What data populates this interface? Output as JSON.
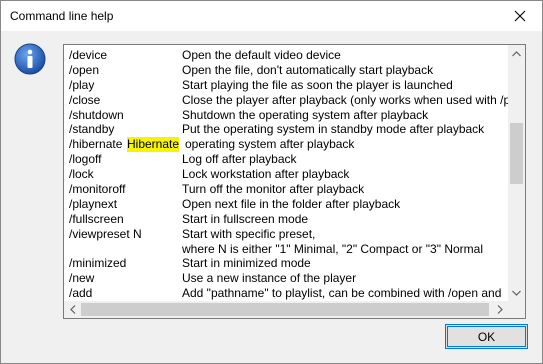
{
  "window": {
    "title": "Command line help"
  },
  "icons": {
    "close": "close-icon",
    "info": "info-icon"
  },
  "colors": {
    "highlight": "#f7f400",
    "button_border": "#0078d7"
  },
  "help": {
    "lines": [
      {
        "cmd": "/device",
        "desc": "Open the default video device"
      },
      {
        "cmd": "/open",
        "desc": "Open the file, don't automatically start playback"
      },
      {
        "cmd": "/play",
        "desc": "Start playing the file as soon the player is launched"
      },
      {
        "cmd": "/close",
        "desc": "Close the player after playback (only works when used with /p"
      },
      {
        "cmd": "/shutdown",
        "desc": "Shutdown the operating system after playback"
      },
      {
        "cmd": "/standby",
        "desc": "Put the operating system in standby mode after playback"
      },
      {
        "cmd": "/hibernate",
        "highlight": "Hibernate",
        "desc": " operating system after playback"
      },
      {
        "cmd": "/logoff",
        "desc": "Log off after playback"
      },
      {
        "cmd": "/lock",
        "desc": "Lock workstation after playback"
      },
      {
        "cmd": "/monitoroff",
        "desc": "Turn off the monitor after playback"
      },
      {
        "cmd": "/playnext",
        "desc": "Open next file in the folder after playback"
      },
      {
        "cmd": "/fullscreen",
        "desc": "Start in fullscreen mode"
      },
      {
        "cmd": "/viewpreset N",
        "desc": "Start with specific preset,"
      },
      {
        "cmd": "",
        "desc": "where N is either \"1\" Minimal, \"2\" Compact or \"3\" Normal"
      },
      {
        "cmd": "/minimized",
        "desc": "Start in minimized mode"
      },
      {
        "cmd": "/new",
        "desc": "Use a new instance of the player"
      },
      {
        "cmd": "/add",
        "desc": "Add \"pathname\" to playlist, can be combined with /open and"
      }
    ]
  },
  "buttons": {
    "ok": "OK"
  }
}
